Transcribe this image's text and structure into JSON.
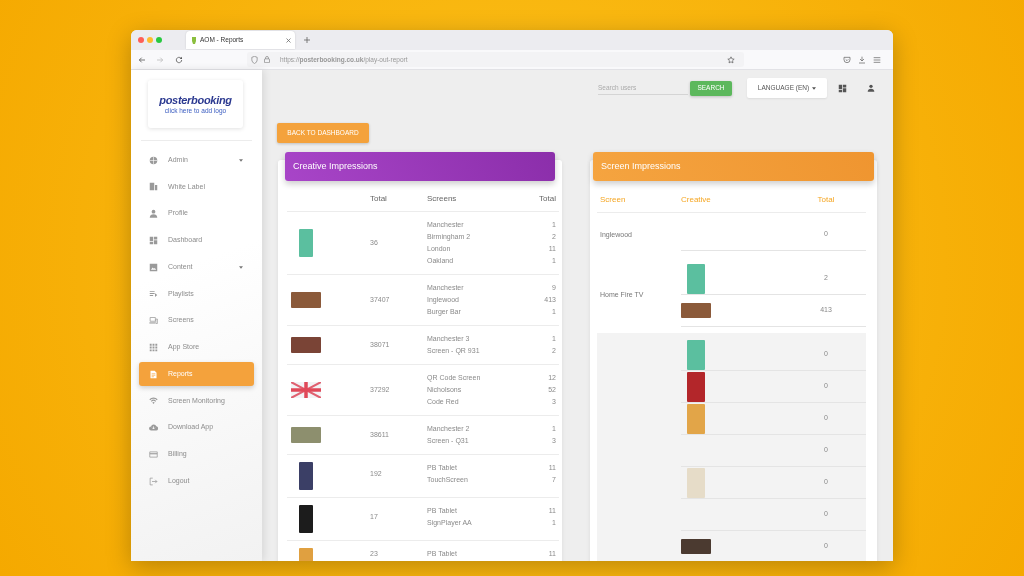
{
  "browser": {
    "tab_title": "AOM - Reports",
    "url": "https://**posterbooking.co.uk**/play-out-report"
  },
  "sidebar": {
    "logo": "posterbooking",
    "logo_link": "click here to add logo",
    "items": [
      {
        "label": "Admin",
        "has_submenu": true,
        "selected": false
      },
      {
        "label": "White Label",
        "has_submenu": false,
        "selected": false
      },
      {
        "label": "Profile",
        "has_submenu": false,
        "selected": false
      },
      {
        "label": "Dashboard",
        "has_submenu": false,
        "selected": false
      },
      {
        "label": "Content",
        "has_submenu": true,
        "selected": false
      },
      {
        "label": "Playlists",
        "has_submenu": false,
        "selected": false
      },
      {
        "label": "Screens",
        "has_submenu": false,
        "selected": false
      },
      {
        "label": "App Store",
        "has_submenu": false,
        "selected": false
      },
      {
        "label": "Reports",
        "has_submenu": false,
        "selected": true
      },
      {
        "label": "Screen Monitoring",
        "has_submenu": false,
        "selected": false
      },
      {
        "label": "Download App",
        "has_submenu": false,
        "selected": false
      },
      {
        "label": "Billing",
        "has_submenu": false,
        "selected": false
      },
      {
        "label": "Logout",
        "has_submenu": false,
        "selected": false
      }
    ]
  },
  "toolbar": {
    "search": {
      "placeholder": "Search users"
    },
    "search_button": "SEARCH",
    "language_button": "LANGUAGE (EN)"
  },
  "back_button": "BACK TO DASHBOARD",
  "creative_impressions": {
    "title": "Creative Impressions",
    "columns": [
      "Total",
      "Screens",
      "Total"
    ],
    "rows": [
      {
        "thumbnail": {
          "kind": "portrait",
          "color": "#5bbf9f"
        },
        "total": "36",
        "screens": [
          {
            "name": "Manchester",
            "total": "1"
          },
          {
            "name": "Birmingham 2",
            "total": "2"
          },
          {
            "name": "London",
            "total": "11"
          },
          {
            "name": "Oakland",
            "total": "1"
          }
        ]
      },
      {
        "thumbnail": {
          "kind": "landscape",
          "color": "#8b5a3a"
        },
        "total": "37407",
        "screens": [
          {
            "name": "Manchester",
            "total": "9"
          },
          {
            "name": "Inglewood",
            "total": "413"
          },
          {
            "name": "Burger Bar",
            "total": "1"
          }
        ]
      },
      {
        "thumbnail": {
          "kind": "landscape",
          "color": "#7a4436"
        },
        "total": "38071",
        "screens": [
          {
            "name": "Manchester 3",
            "total": "1"
          },
          {
            "name": "Screen - QR 931",
            "total": "2"
          }
        ]
      },
      {
        "thumbnail": {
          "kind": "flag"
        },
        "total": "37292",
        "screens": [
          {
            "name": "QR Code Screen",
            "total": "12"
          },
          {
            "name": "Nicholsons",
            "total": "52"
          },
          {
            "name": "Code Red",
            "total": "3"
          }
        ]
      },
      {
        "thumbnail": {
          "kind": "landscape",
          "color": "#8d8f6e"
        },
        "total": "38611",
        "screens": [
          {
            "name": "Manchester 2",
            "total": "1"
          },
          {
            "name": "Screen - Q31",
            "total": "3"
          }
        ]
      },
      {
        "thumbnail": {
          "kind": "portrait",
          "color": "#3b3f66"
        },
        "total": "192",
        "screens": [
          {
            "name": "PB Tablet",
            "total": "11"
          },
          {
            "name": "TouchScreen",
            "total": "7"
          }
        ]
      },
      {
        "thumbnail": {
          "kind": "portrait",
          "color": "#1c1c1c"
        },
        "total": "17",
        "screens": [
          {
            "name": "PB Tablet",
            "total": "11"
          },
          {
            "name": "SignPlayer AA",
            "total": "1"
          }
        ]
      },
      {
        "thumbnail": {
          "kind": "portrait",
          "color": "#e0a040"
        },
        "total": "23",
        "screens": [
          {
            "name": "PB Tablet",
            "total": "11"
          }
        ]
      }
    ]
  },
  "screen_impressions": {
    "title": "Screen Impressions",
    "columns": [
      "Screen",
      "Creative",
      "Total"
    ],
    "groups": [
      {
        "screen": "Inglewood",
        "highlighted": false,
        "entries": [
          {
            "total": "0"
          }
        ]
      },
      {
        "screen": "Home Fire TV",
        "highlighted": false,
        "entries": [
          {
            "thumbnail": {
              "kind": "portrait",
              "color": "#5bbf9f"
            },
            "total": "2"
          },
          {
            "thumbnail": {
              "kind": "landscape",
              "color": "#8b5a3a"
            },
            "total": "413"
          }
        ]
      },
      {
        "highlighted": true,
        "entries": [
          {
            "thumbnail": {
              "kind": "portrait",
              "color": "#5bbf9f"
            },
            "total": "0"
          },
          {
            "thumbnail": {
              "kind": "portrait",
              "color": "#b3262a"
            },
            "total": "0"
          },
          {
            "thumbnail": {
              "kind": "portrait",
              "color": "#e2a548"
            },
            "total": "0"
          },
          {
            "total": "0"
          },
          {
            "thumbnail": {
              "kind": "portrait",
              "color": "#e6dcc8"
            },
            "total": "0"
          },
          {
            "total": "0"
          },
          {
            "thumbnail": {
              "kind": "landscape",
              "color": "#4b3a30"
            },
            "total": "0"
          }
        ]
      }
    ]
  }
}
